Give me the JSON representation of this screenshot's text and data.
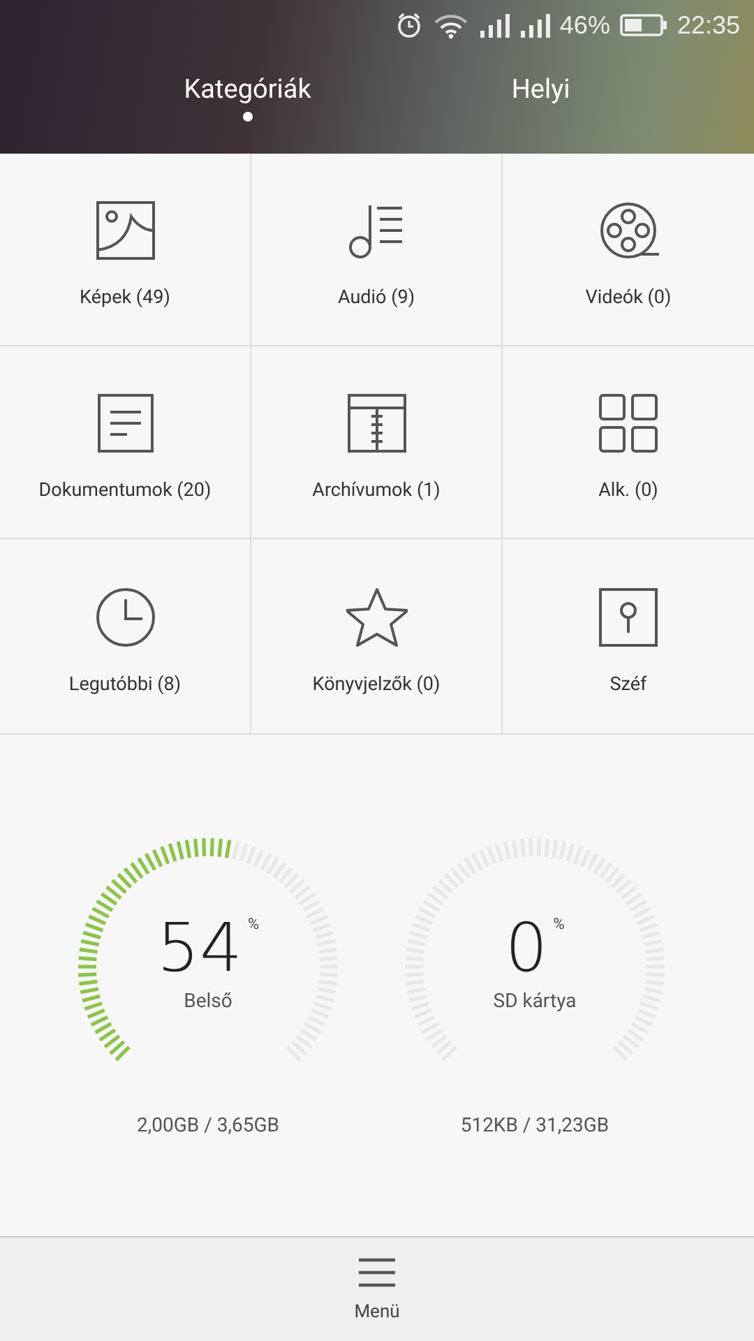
{
  "status_bar": {
    "battery": "46%",
    "time": "22:35"
  },
  "tabs": [
    {
      "label": "Kategóriák",
      "selected": true
    },
    {
      "label": "Helyi",
      "selected": false
    }
  ],
  "categories": [
    {
      "kind": "images",
      "label": "Képek (49)"
    },
    {
      "kind": "audio",
      "label": "Audió (9)"
    },
    {
      "kind": "video",
      "label": "Videók (0)"
    },
    {
      "kind": "documents",
      "label": "Dokumentumok (20)"
    },
    {
      "kind": "archives",
      "label": "Archívumok (1)"
    },
    {
      "kind": "apps",
      "label": "Alk. (0)"
    },
    {
      "kind": "recent",
      "label": "Legutóbbi (8)"
    },
    {
      "kind": "bookmarks",
      "label": "Könyvjelzők (0)"
    },
    {
      "kind": "safe",
      "label": "Széf"
    }
  ],
  "storage": [
    {
      "percent": "54",
      "unit": "%",
      "name": "Belső",
      "usage": "2,00GB / 3,65GB"
    },
    {
      "percent": "0",
      "unit": "%",
      "name": "SD kártya",
      "usage": "512KB / 31,23GB"
    }
  ],
  "bottom_bar": {
    "label": "Menü"
  }
}
